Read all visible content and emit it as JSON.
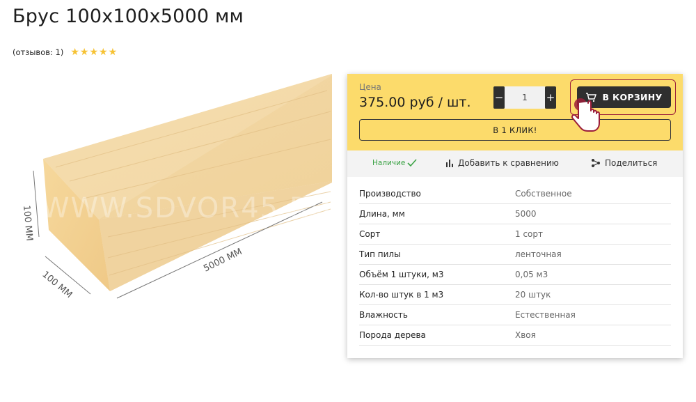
{
  "product": {
    "title": "Брус 100х100х5000 мм",
    "reviews_label": "(отзывов: 1)",
    "rating": 5,
    "stars": [
      "★",
      "★",
      "★",
      "★",
      "★"
    ]
  },
  "image": {
    "dim_height": "100 MM",
    "dim_width": "100 MM",
    "dim_length": "5000 MM",
    "watermark": "WWW.SDVOR45.RU"
  },
  "buy": {
    "price_label": "Цена",
    "price_value": "375.00 руб / шт.",
    "qty_minus": "−",
    "qty_plus": "+",
    "qty_value": "1",
    "cart_label": "В КОРЗИНУ",
    "one_click_label": "В 1 КЛИК!"
  },
  "info": {
    "availability": "Наличие",
    "compare": "Добавить к сравнению",
    "share": "Поделиться"
  },
  "specs": [
    {
      "name": "Производство",
      "value": "Собственное"
    },
    {
      "name": "Длина, мм",
      "value": "5000"
    },
    {
      "name": "Сорт",
      "value": "1 сорт"
    },
    {
      "name": "Тип пилы",
      "value": "ленточная"
    },
    {
      "name": "Объём 1 штуки, м3",
      "value": "0,05 м3"
    },
    {
      "name": "Кол-во штук в 1 м3",
      "value": "20 штук"
    },
    {
      "name": "Влажность",
      "value": "Естественная"
    },
    {
      "name": "Порода дерева",
      "value": "Хвоя"
    }
  ],
  "colors": {
    "accent_yellow": "#fcdb6b",
    "dark_button": "#2f2f2f",
    "highlight_red": "#9b1d3a",
    "available_green": "#3aa244",
    "star_yellow": "#f6c233"
  }
}
